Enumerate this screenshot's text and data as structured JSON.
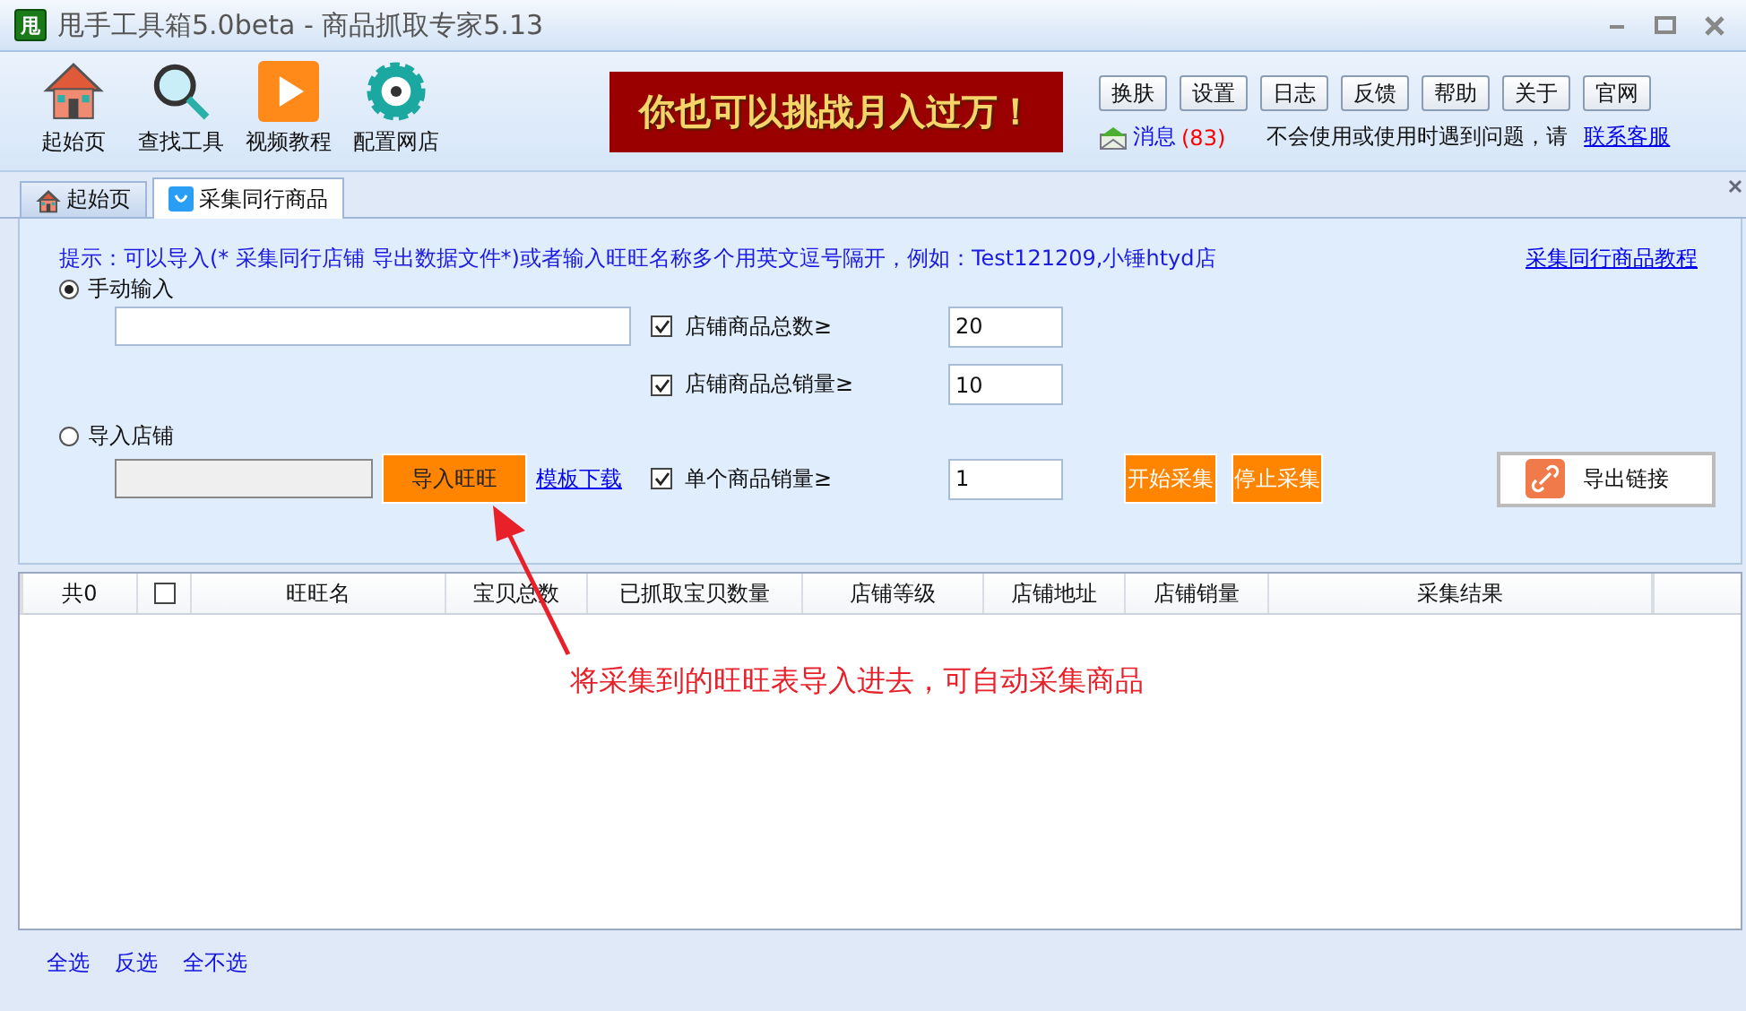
{
  "window": {
    "title": "甩手工具箱5.0beta - 商品抓取专家5.13",
    "app_icon_text": "甩"
  },
  "toolbar": {
    "tools": [
      {
        "label": "起始页",
        "kind": "house"
      },
      {
        "label": "查找工具",
        "kind": "magnifier"
      },
      {
        "label": "视频教程",
        "kind": "play"
      },
      {
        "label": "配置网店",
        "kind": "gear"
      }
    ],
    "banner": "你也可以挑战月入过万！",
    "buttons": [
      "换肤",
      "设置",
      "日志",
      "反馈",
      "帮助",
      "关于",
      "官网"
    ],
    "messages": {
      "label": "消息",
      "count": "(83)"
    },
    "help_text": "不会使用或使用时遇到问题，请",
    "help_link": "联系客服"
  },
  "tabs": [
    {
      "label": "起始页",
      "kind": "house",
      "selected": false
    },
    {
      "label": "采集同行商品",
      "kind": "bag",
      "selected": true
    }
  ],
  "panel": {
    "hint": "提示：可以导入(* 采集同行店铺 导出数据文件*)或者输入旺旺名称多个用英文逗号隔开，例如：Test121209,小锤htyd店",
    "tutorial_link": "采集同行商品教程",
    "sources": [
      {
        "label": "手动输入",
        "selected": true
      },
      {
        "label": "导入店铺",
        "selected": false
      }
    ],
    "import_field": {
      "disabled": true
    },
    "import_button": "导入旺旺",
    "template_link": "模板下载",
    "filters": [
      {
        "label": "店铺商品总数≥",
        "checked": true,
        "value": "20"
      },
      {
        "label": "店铺商品总销量≥",
        "checked": true,
        "value": "10"
      },
      {
        "label": "单个商品销量≥",
        "checked": true,
        "value": "1"
      }
    ],
    "start_button": "开始采集",
    "stop_button": "停止采集",
    "export_button": "导出链接"
  },
  "table": {
    "count_column": "共0",
    "select_all_checked": false,
    "columns": [
      "旺旺名",
      "宝贝总数",
      "已抓取宝贝数量",
      "店铺等级",
      "店铺地址",
      "店铺销量",
      "采集结果"
    ]
  },
  "annotation": "将采集到的旺旺表导入进去，可自动采集商品",
  "footer_links": [
    "全选",
    "反选",
    "全不选"
  ]
}
